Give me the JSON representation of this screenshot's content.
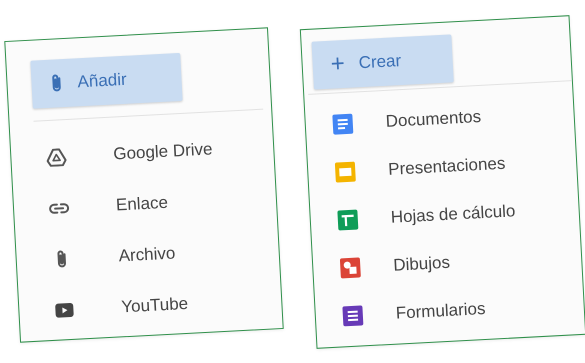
{
  "left_panel": {
    "add_button_label": "Añadir",
    "items": [
      {
        "label": "Google Drive",
        "icon": "google-drive-icon"
      },
      {
        "label": "Enlace",
        "icon": "link-icon"
      },
      {
        "label": "Archivo",
        "icon": "paperclip-icon"
      },
      {
        "label": "YouTube",
        "icon": "youtube-icon"
      }
    ]
  },
  "right_panel": {
    "create_button_label": "Crear",
    "items": [
      {
        "label": "Documentos",
        "icon": "docs-icon",
        "color": "#4285f4"
      },
      {
        "label": "Presentaciones",
        "icon": "slides-icon",
        "color": "#f4b400"
      },
      {
        "label": "Hojas de cálculo",
        "icon": "sheets-icon",
        "color": "#0f9d58"
      },
      {
        "label": "Dibujos",
        "icon": "drawings-icon",
        "color": "#db4437"
      },
      {
        "label": "Formularios",
        "icon": "forms-icon",
        "color": "#673ab7"
      }
    ]
  },
  "colors": {
    "accent_blue": "#3a6fb5",
    "chip_bg": "#c9dcf2",
    "border_green": "#2f8f4a"
  }
}
